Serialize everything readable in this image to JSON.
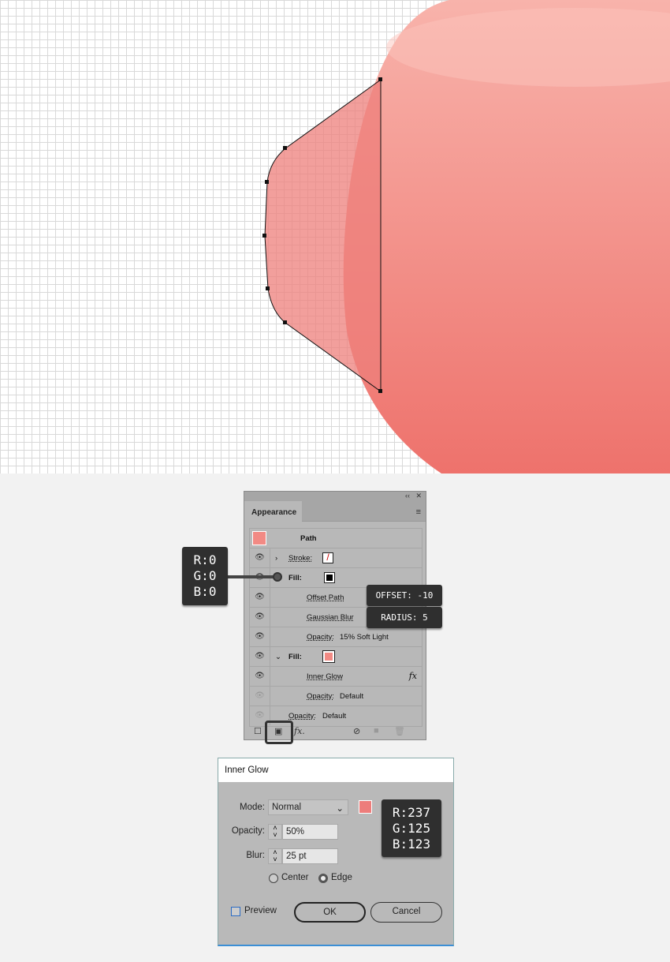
{
  "canvas": {
    "object_color": "#f28a84",
    "path_fill": "#ed7d7b"
  },
  "panel": {
    "tab": "Appearance",
    "rows": [
      {
        "label": "Path"
      },
      {
        "label": "Stroke:"
      },
      {
        "label": "Fill:"
      },
      {
        "label": "Offset Path"
      },
      {
        "label": "Gaussian Blur"
      },
      {
        "label": "Opacity:",
        "value": "15% Soft Light"
      },
      {
        "label": "Fill:"
      },
      {
        "label": "Inner Glow",
        "fx": "fx"
      },
      {
        "label": "Opacity:",
        "value": "Default"
      },
      {
        "label": "Opacity:",
        "value": "Default"
      }
    ],
    "fx_button": "fx.",
    "fill_black": "#000000",
    "fill_pink": "#f28a84"
  },
  "tips": {
    "rgb_black": [
      "R:0",
      "G:0",
      "B:0"
    ],
    "offset": "OFFSET: -10",
    "radius": "RADIUS: 5",
    "rgb_pink": [
      "R:237",
      "G:125",
      "B:123"
    ]
  },
  "dialog": {
    "title": "Inner Glow",
    "mode_label": "Mode:",
    "mode": "Normal",
    "opacity_label": "Opacity:",
    "opacity": "50%",
    "blur_label": "Blur:",
    "blur": "25 pt",
    "center": "Center",
    "edge": "Edge",
    "selected": "Edge",
    "preview": "Preview",
    "preview_checked": false,
    "ok": "OK",
    "cancel": "Cancel",
    "color": "#ed7d7b"
  }
}
